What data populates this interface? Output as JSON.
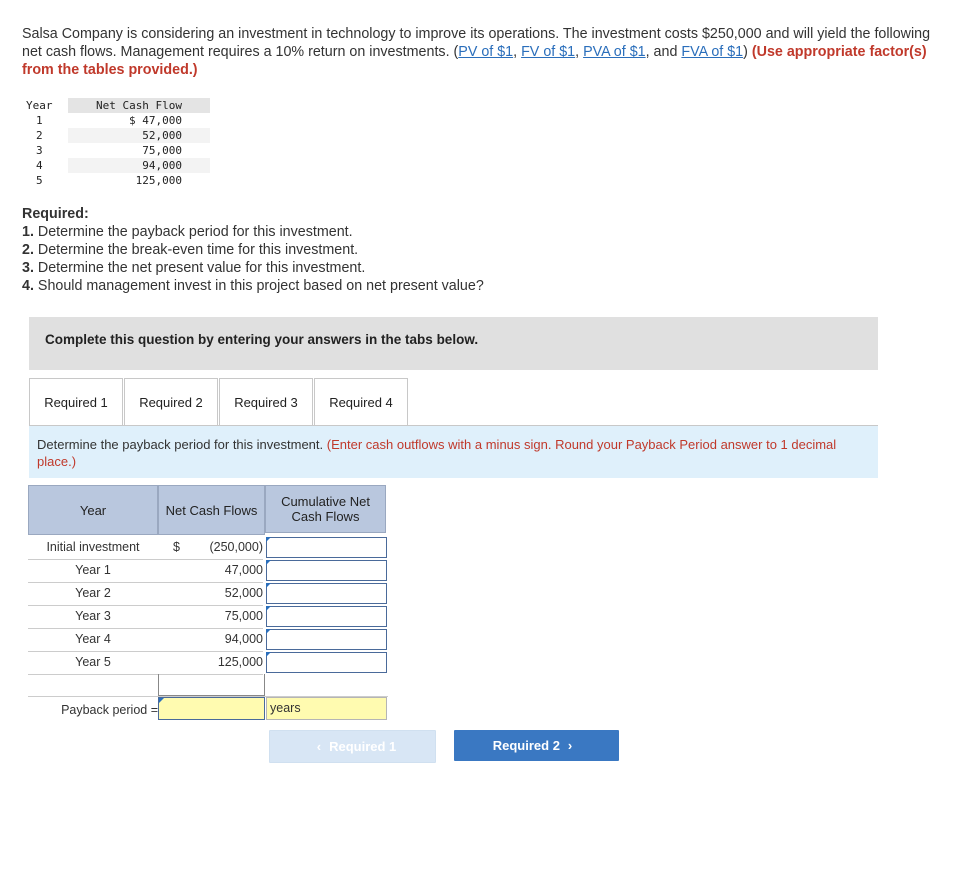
{
  "intro": {
    "text_pre": "Salsa Company is considering an investment in technology to improve its operations. The investment costs $250,000 and will yield the following net cash flows. Management requires a 10% return on investments. (",
    "links": [
      "PV of $1",
      "FV of $1",
      "PVA of $1",
      "FVA of $1"
    ],
    "sep1": ", ",
    "sep2": ", ",
    "sep3": ", and ",
    "close_paren": ") ",
    "use_tables": "(Use appropriate factor(s) from the tables provided.)"
  },
  "cash_table": {
    "headers": [
      "Year",
      "Net Cash Flow"
    ],
    "rows": [
      {
        "year": "1",
        "flow": "$ 47,000"
      },
      {
        "year": "2",
        "flow": "52,000"
      },
      {
        "year": "3",
        "flow": "75,000"
      },
      {
        "year": "4",
        "flow": "94,000"
      },
      {
        "year": "5",
        "flow": "125,000"
      }
    ]
  },
  "required": {
    "heading": "Required:",
    "items": [
      {
        "num": "1.",
        "text": " Determine the payback period for this investment."
      },
      {
        "num": "2.",
        "text": " Determine the break-even time for this investment."
      },
      {
        "num": "3.",
        "text": " Determine the net present value for this investment."
      },
      {
        "num": "4.",
        "text": " Should management invest in this project based on net present value?"
      }
    ]
  },
  "banner": "Complete this question by entering your answers in the tabs below.",
  "tabs": [
    "Required 1",
    "Required 2",
    "Required 3",
    "Required 4"
  ],
  "instruction": {
    "main": "Determine the payback period for this investment. ",
    "note": "(Enter cash outflows with a minus sign. Round your Payback Period answer to 1 decimal place.)"
  },
  "worksheet": {
    "headers": [
      "Year",
      "Net Cash Flows",
      "Cumulative Net Cash Flows"
    ],
    "dollar": "$",
    "rows": [
      {
        "label": "Initial investment",
        "value": "(250,000)"
      },
      {
        "label": "Year 1",
        "value": "47,000"
      },
      {
        "label": "Year 2",
        "value": "52,000"
      },
      {
        "label": "Year 3",
        "value": "75,000"
      },
      {
        "label": "Year 4",
        "value": "94,000"
      },
      {
        "label": "Year 5",
        "value": "125,000"
      }
    ],
    "payback_label": "Payback period =",
    "years_unit": "years"
  },
  "nav": {
    "prev_label": "Required 1",
    "next_label": "Required 2"
  }
}
